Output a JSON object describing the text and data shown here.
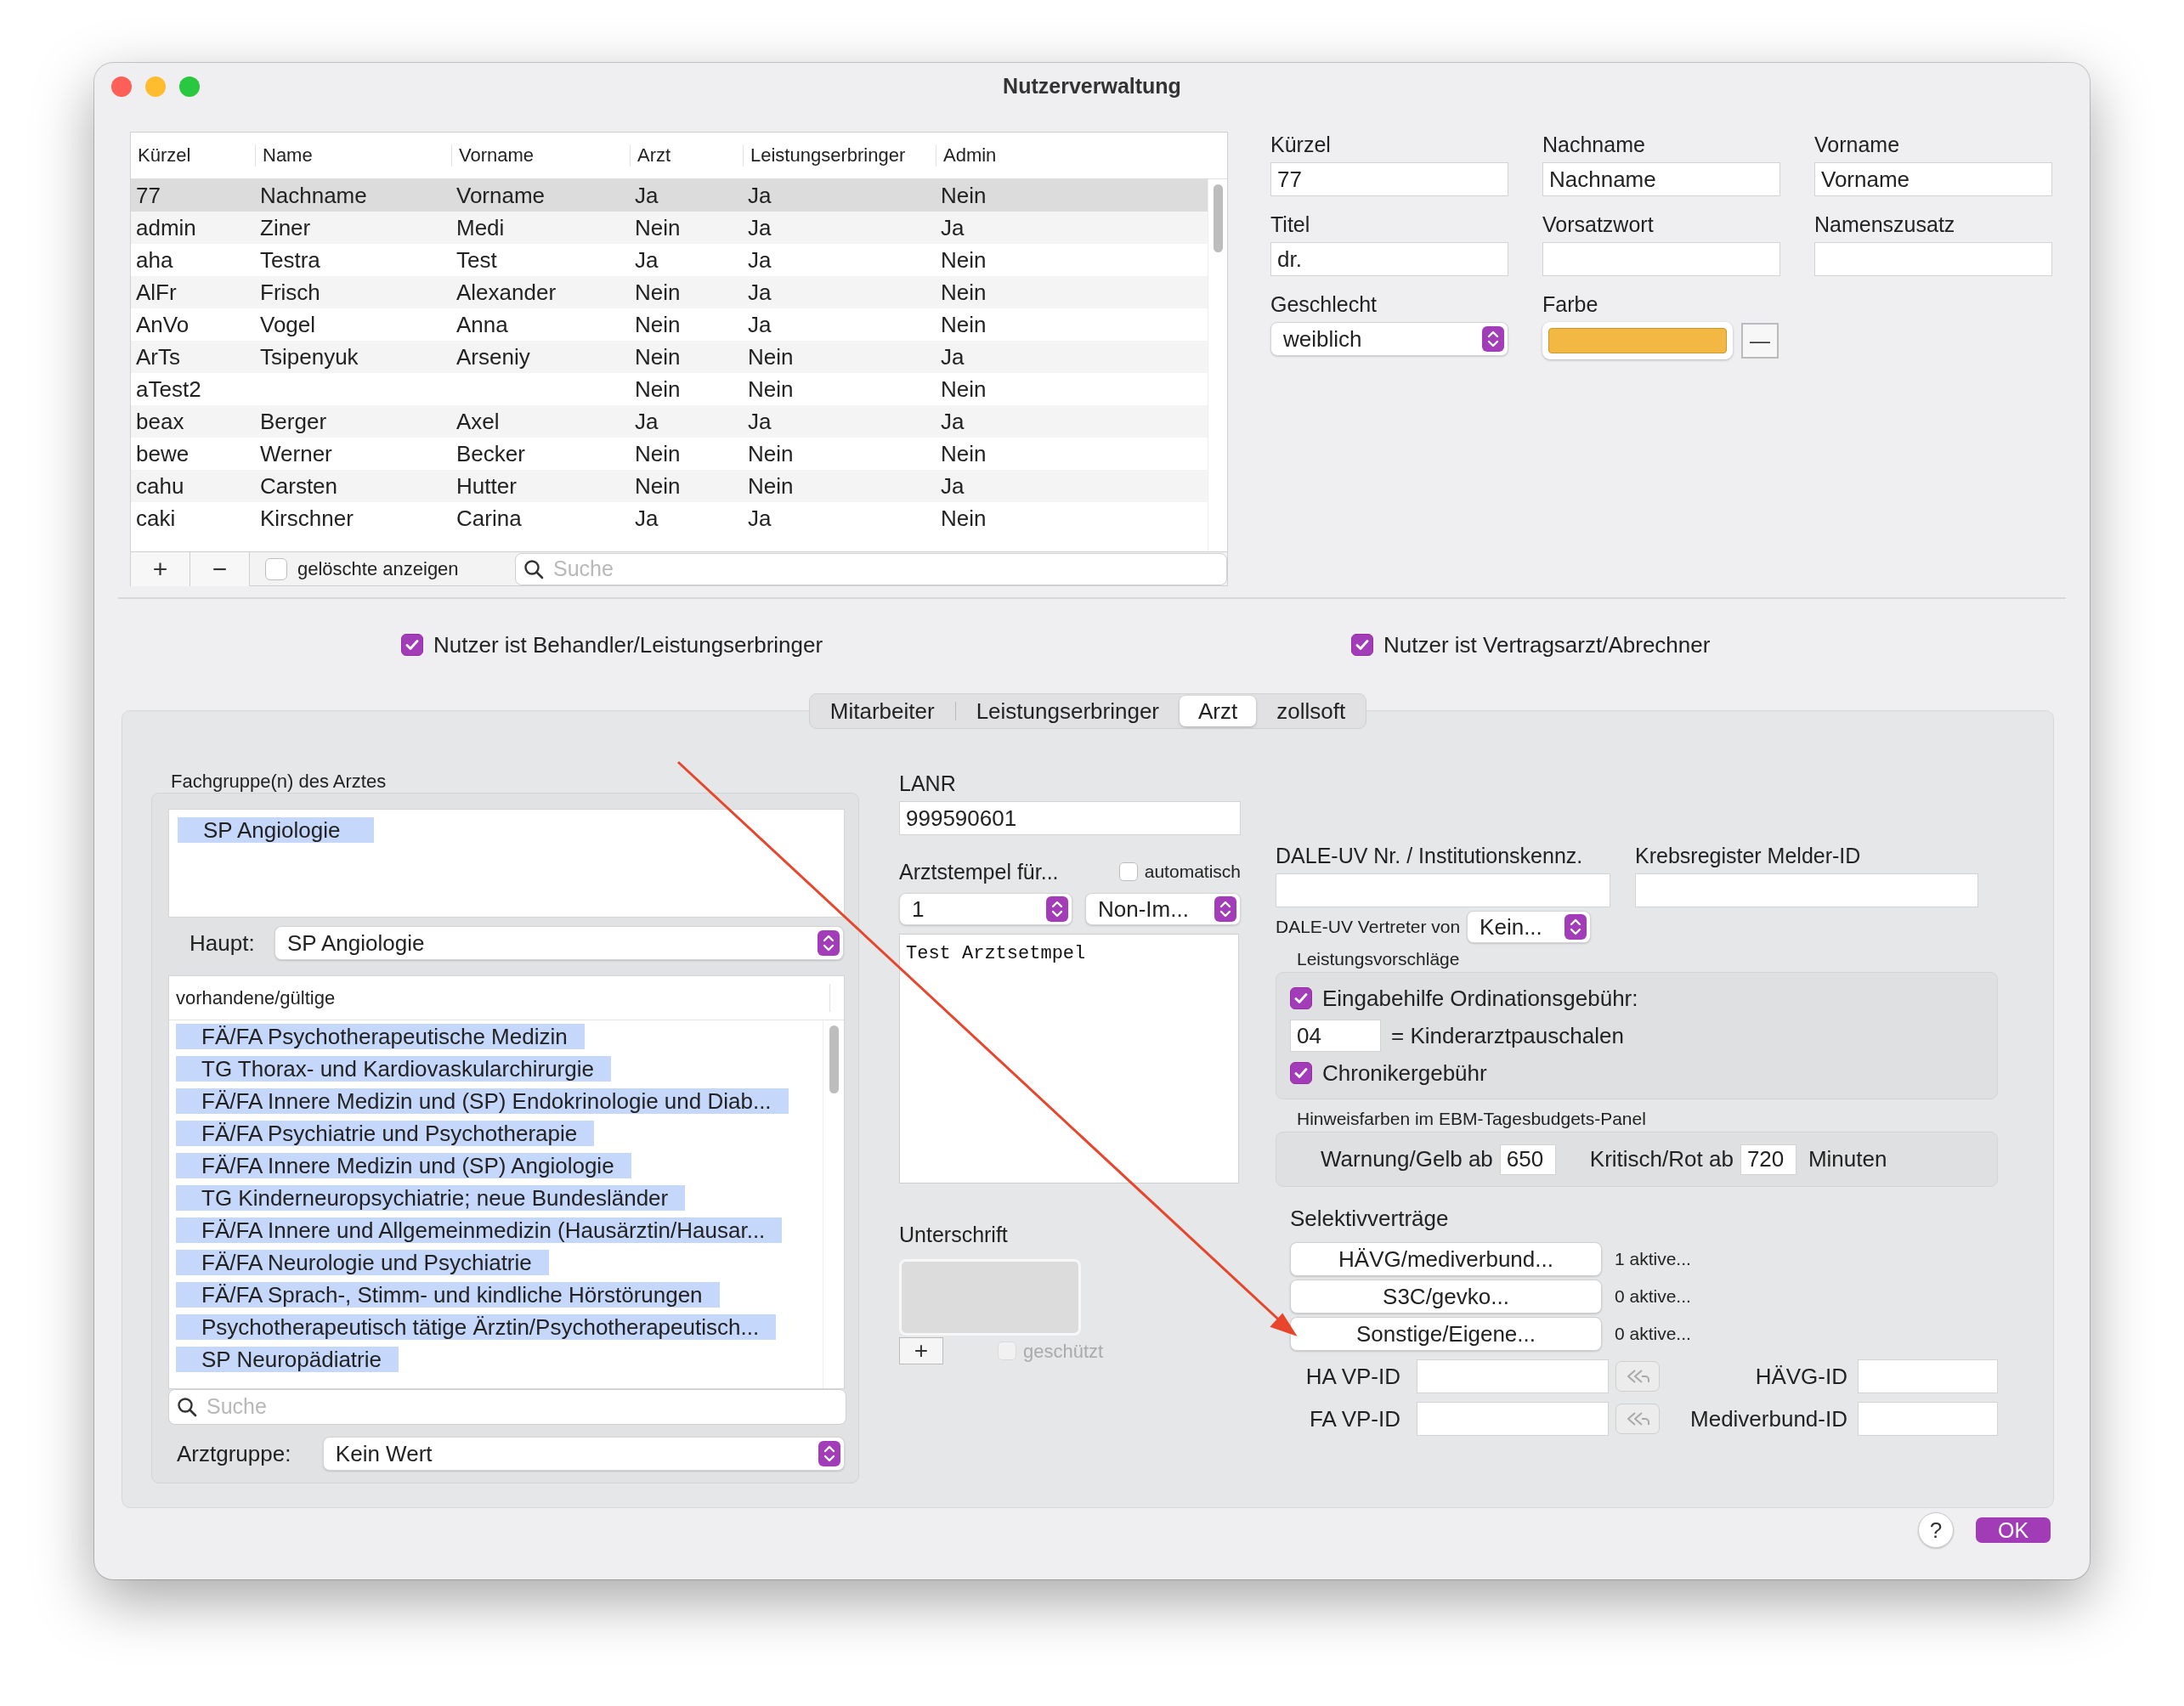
{
  "window": {
    "title": "Nutzerverwaltung"
  },
  "users_table": {
    "columns": [
      "Kürzel",
      "Name",
      "Vorname",
      "Arzt",
      "Leistungserbringer",
      "Admin"
    ],
    "rows": [
      {
        "kuerzel": "77",
        "name": "Nachname",
        "vorname": "Vorname",
        "arzt": "Ja",
        "leistungserbringer": "Ja",
        "admin": "Nein",
        "selected": true
      },
      {
        "kuerzel": "admin",
        "name": "Ziner",
        "vorname": "Medi",
        "arzt": "Nein",
        "leistungserbringer": "Ja",
        "admin": "Ja",
        "selected": false
      },
      {
        "kuerzel": "aha",
        "name": "Testra",
        "vorname": "Test",
        "arzt": "Ja",
        "leistungserbringer": "Ja",
        "admin": "Nein",
        "selected": false
      },
      {
        "kuerzel": "AlFr",
        "name": "Frisch",
        "vorname": "Alexander",
        "arzt": "Nein",
        "leistungserbringer": "Ja",
        "admin": "Nein",
        "selected": false
      },
      {
        "kuerzel": "AnVo",
        "name": "Vogel",
        "vorname": "Anna",
        "arzt": "Nein",
        "leistungserbringer": "Ja",
        "admin": "Nein",
        "selected": false
      },
      {
        "kuerzel": "ArTs",
        "name": "Tsipenyuk",
        "vorname": "Arseniy",
        "arzt": "Nein",
        "leistungserbringer": "Nein",
        "admin": "Ja",
        "selected": false
      },
      {
        "kuerzel": "aTest2",
        "arzt": "Nein",
        "leistungserbringer": "Nein",
        "admin": "Nein",
        "selected": false
      },
      {
        "kuerzel": "beax",
        "name": "Berger",
        "vorname": "Axel",
        "arzt": "Ja",
        "leistungserbringer": "Ja",
        "admin": "Ja",
        "selected": false
      },
      {
        "kuerzel": "bewe",
        "name": "Werner",
        "vorname": "Becker",
        "arzt": "Nein",
        "leistungserbringer": "Nein",
        "admin": "Nein",
        "selected": false
      },
      {
        "kuerzel": "cahu",
        "name": "Carsten",
        "vorname": "Hutter",
        "arzt": "Nein",
        "leistungserbringer": "Nein",
        "admin": "Ja",
        "selected": false
      },
      {
        "kuerzel": "caki",
        "name": "Kirschner",
        "vorname": "Carina",
        "arzt": "Ja",
        "leistungserbringer": "Ja",
        "admin": "Nein",
        "selected": false
      }
    ],
    "footer": {
      "add": "+",
      "remove": "−",
      "show_deleted": {
        "label": "gelöschte anzeigen",
        "checked": false
      },
      "search": {
        "placeholder": "Suche"
      }
    }
  },
  "user_form": {
    "fields": [
      {
        "label": "Kürzel",
        "value": "77"
      },
      {
        "label": "Nachname",
        "value": "Nachname"
      },
      {
        "label": "Vorname",
        "value": "Vorname"
      },
      {
        "label": "Titel",
        "value": "dr."
      },
      {
        "label": "Vorsatzwort"
      },
      {
        "label": "Namenszusatz"
      }
    ],
    "gender": {
      "label": "Geschlecht",
      "value": "weiblich"
    },
    "color": {
      "label": "Farbe",
      "color": "#f2b843",
      "remove": "—"
    }
  },
  "roles": [
    {
      "label": "Nutzer ist Behandler/Leistungserbringer",
      "checked": true
    },
    {
      "label": "Nutzer ist Vertragsarzt/Abrechner",
      "checked": true
    }
  ],
  "tabs": [
    {
      "label": "Mitarbeiter",
      "selected": false
    },
    {
      "label": "Leistungserbringer",
      "selected": false
    },
    {
      "label": "Arzt",
      "selected": true
    },
    {
      "label": "zollsoft",
      "selected": false
    }
  ],
  "fachgruppen": {
    "title": "Fachgruppe(n) des Arztes",
    "chosen": [
      "SP Angiologie"
    ],
    "haupt": {
      "label": "Haupt:",
      "value": "SP Angiologie"
    },
    "available_header": "vorhandene/gültige",
    "available": [
      "FÄ/FA Psychotherapeutische Medizin",
      "TG Thorax- und Kardiovaskularchirurgie",
      "FÄ/FA Innere Medizin und (SP) Endokrinologie und Diab...",
      "FÄ/FA Psychiatrie und Psychotherapie",
      "FÄ/FA Innere Medizin und (SP) Angiologie",
      "TG Kinderneuropsychiatrie; neue Bundesländer",
      "FÄ/FA Innere und Allgemeinmedizin (Hausärztin/Hausar...",
      "FÄ/FA Neurologie und Psychiatrie",
      "FÄ/FA Sprach-, Stimm- und kindliche Hörstörungen",
      "Psychotherapeutisch tätige Ärztin/Psychotherapeutisch...",
      "SP Neuropädiatrie"
    ],
    "search": {
      "placeholder": "Suche"
    },
    "arztgruppe": {
      "label": "Arztgruppe:",
      "value": "Kein Wert"
    }
  },
  "lanr": {
    "label": "LANR",
    "value": "999590601"
  },
  "stamp": {
    "label": "Arztstempel für...",
    "auto": {
      "label": "automatisch",
      "checked": false
    },
    "number": "1",
    "mode": "Non-Im...",
    "text": "Test Arztsetmpel"
  },
  "signature": {
    "label": "Unterschrift",
    "add": "+",
    "protected": {
      "label": "geschützt",
      "checked": false,
      "disabled": true
    }
  },
  "dale": {
    "label": "DALE-UV Nr. / Institutionskennz."
  },
  "krebsregister": {
    "label": "Krebsregister Melder-ID"
  },
  "dale_vertreter": {
    "label": "DALE-UV Vertreter von",
    "value": "Kein..."
  },
  "leistungsvorschlaege": {
    "title": "Leistungsvorschläge",
    "ordination": {
      "label": "Eingabehilfe Ordinationsgebühr:",
      "checked": true
    },
    "code": "04",
    "code_label": "= Kinderarztpauschalen",
    "chroniker": {
      "label": "Chronikergebühr",
      "checked": true
    }
  },
  "hinweisfarben": {
    "title": "Hinweisfarben im EBM-Tagesbudgets-Panel",
    "warn_label": "Warnung/Gelb ab",
    "warn": "650",
    "crit_label": "Kritisch/Rot ab",
    "crit": "720",
    "unit": "Minuten"
  },
  "selektivvertraege": {
    "title": "Selektivverträge",
    "contracts": [
      {
        "button": "HÄVG/mediverbund...",
        "status": "1 aktive..."
      },
      {
        "button": "S3C/gevko...",
        "status": "0 aktive..."
      },
      {
        "button": "Sonstige/Eigene...",
        "status": "0 aktive..."
      }
    ]
  },
  "id_rows": [
    {
      "label": "HA VP-ID",
      "label2": "HÄVG-ID"
    },
    {
      "label": "FA VP-ID",
      "label2": "Mediverbund-ID"
    }
  ],
  "dialog_buttons": {
    "help": "?",
    "ok": "OK"
  },
  "annotations": [
    {
      "kind": "arrow"
    }
  ]
}
